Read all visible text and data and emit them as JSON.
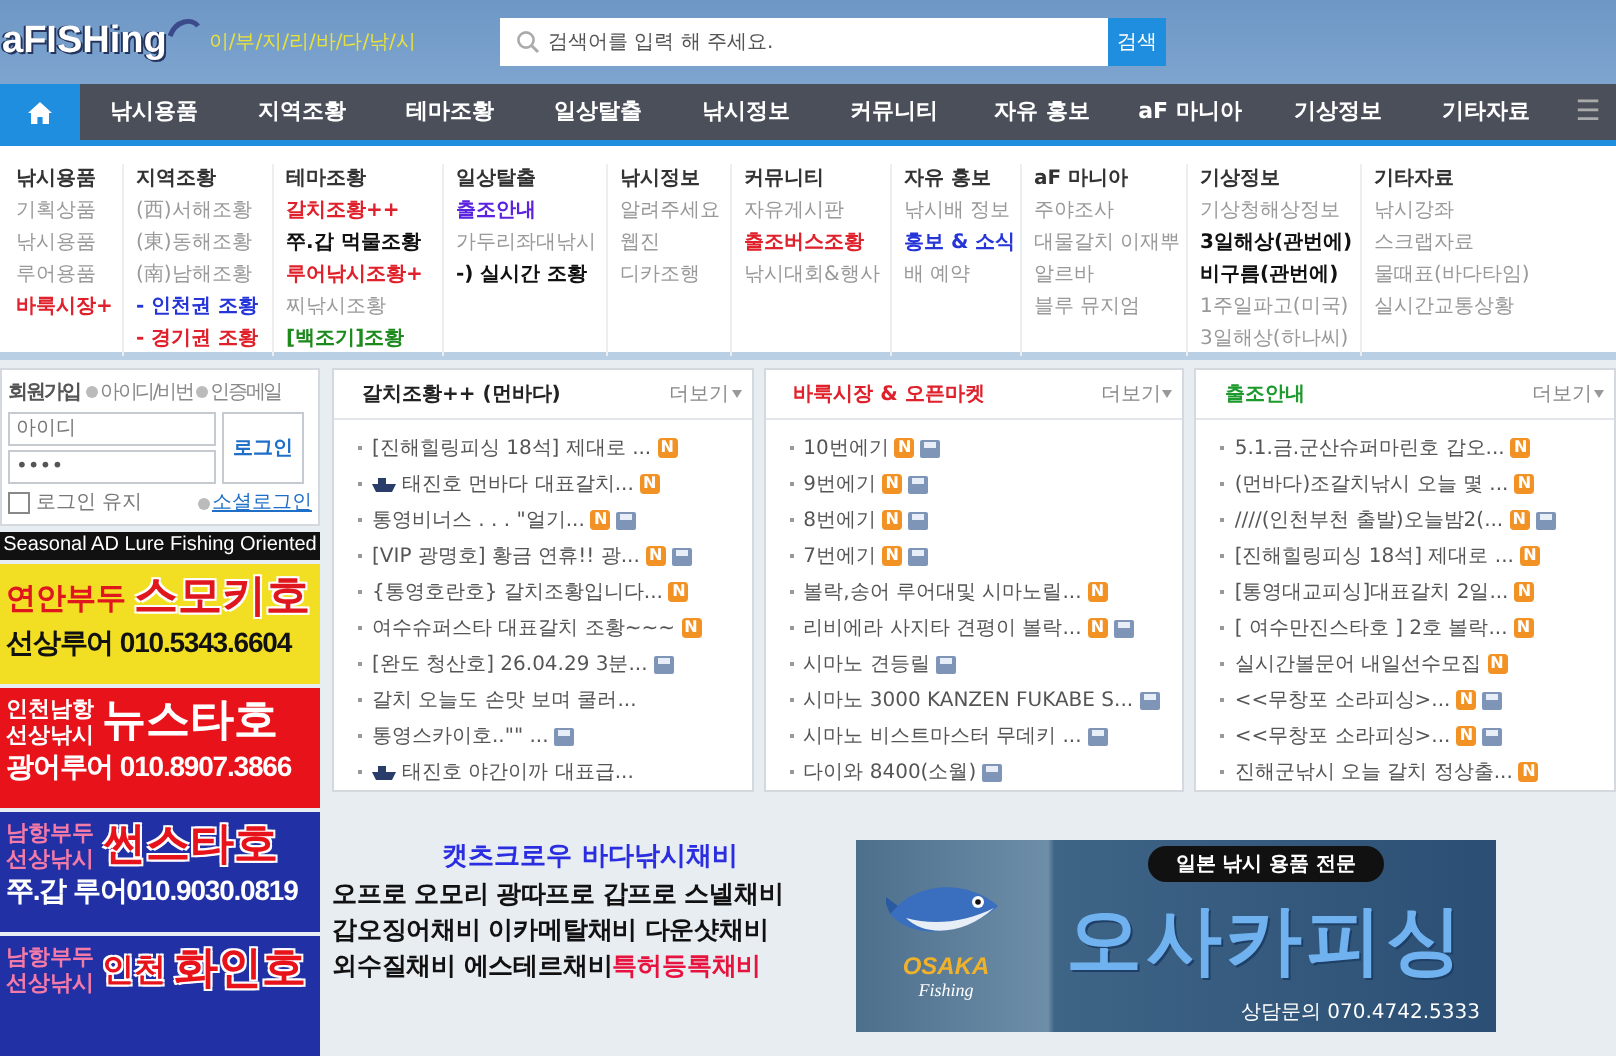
{
  "header": {
    "logo": "aFISHing",
    "slogan": "이/부/지/리/바/다/낚/시",
    "search": {
      "placeholder": "검색어를 입력 해 주세요.",
      "button": "검색"
    }
  },
  "nav": {
    "items": [
      {
        "label": "낚시용품",
        "selected": false
      },
      {
        "label": "지역조황",
        "selected": false
      },
      {
        "label": "테마조황",
        "selected": false
      },
      {
        "label": "일상탈출",
        "selected": false
      },
      {
        "label": "낚시정보",
        "selected": false
      },
      {
        "label": "커뮤니티",
        "selected": false
      },
      {
        "label": "자유 홍보",
        "selected": false
      },
      {
        "label": "aF 마니아",
        "selected": false
      },
      {
        "label": "기상정보",
        "selected": false
      },
      {
        "label": "기타자료",
        "selected": false
      }
    ],
    "home_selected": true,
    "menu_glyph": "☰"
  },
  "mega_menu": [
    {
      "heading": "낚시용품",
      "items": [
        {
          "label": "기획상품",
          "kind": "plain"
        },
        {
          "label": "낚시용품",
          "kind": "plain"
        },
        {
          "label": "루어용품",
          "kind": "plain"
        },
        {
          "label": "바룩시장+",
          "kind": "red"
        }
      ]
    },
    {
      "heading": "지역조황",
      "items": [
        {
          "label": "(西)서해조황",
          "kind": "plain"
        },
        {
          "label": "(東)동해조황",
          "kind": "plain"
        },
        {
          "label": "(南)남해조황",
          "kind": "plain"
        },
        {
          "label": "- 인천권 조황",
          "kind": "blue"
        },
        {
          "label": "- 경기권 조황",
          "kind": "red"
        }
      ]
    },
    {
      "heading": "테마조황",
      "items": [
        {
          "label": "갈치조황++",
          "kind": "red"
        },
        {
          "label": "쭈.갑 먹물조황",
          "kind": "black"
        },
        {
          "label": "루어낚시조황+",
          "kind": "red"
        },
        {
          "label": "찌낚시조황",
          "kind": "plain"
        },
        {
          "label": "[백조기]조황",
          "kind": "green"
        }
      ]
    },
    {
      "heading": "일상탈출",
      "items": [
        {
          "label": "출조안내",
          "kind": "purple"
        },
        {
          "label": "가두리좌대낚시",
          "kind": "plain"
        },
        {
          "label": "-) 실시간 조황",
          "kind": "black"
        }
      ]
    },
    {
      "heading": "낚시정보",
      "items": [
        {
          "label": "알려주세요",
          "kind": "plain"
        },
        {
          "label": "웹진",
          "kind": "plain"
        },
        {
          "label": "디카조행",
          "kind": "plain"
        }
      ]
    },
    {
      "heading": "커뮤니티",
      "items": [
        {
          "label": "자유게시판",
          "kind": "plain"
        },
        {
          "label": "출조버스조황",
          "kind": "red"
        },
        {
          "label": "낚시대회&행사",
          "kind": "plain"
        }
      ]
    },
    {
      "heading": "자유 홍보",
      "items": [
        {
          "label": "낚시배 정보",
          "kind": "plain"
        },
        {
          "label": "홍보 & 소식",
          "kind": "blue"
        },
        {
          "label": "배 예약",
          "kind": "plain"
        }
      ]
    },
    {
      "heading": "aF 마니아",
      "items": [
        {
          "label": "주야조사",
          "kind": "plain"
        },
        {
          "label": "대물갈치 이재뿌",
          "kind": "plain"
        },
        {
          "label": "알르바",
          "kind": "plain"
        },
        {
          "label": "블루 뮤지엄",
          "kind": "plain"
        }
      ]
    },
    {
      "heading": "기상정보",
      "items": [
        {
          "label": "기상청해상정보",
          "kind": "plain"
        },
        {
          "label": "3일해상(관번에)",
          "kind": "black"
        },
        {
          "label": "비구름(관번에)",
          "kind": "black"
        },
        {
          "label": "1주일파고(미국)",
          "kind": "plain"
        },
        {
          "label": "3일해상(하나씨)",
          "kind": "plain"
        }
      ]
    },
    {
      "heading": "기타자료",
      "items": [
        {
          "label": "낚시강좌",
          "kind": "plain"
        },
        {
          "label": "스크랩자료",
          "kind": "plain"
        },
        {
          "label": "물때표(바다타임)",
          "kind": "plain"
        },
        {
          "label": "실시간교통상황",
          "kind": "plain"
        }
      ]
    }
  ],
  "login": {
    "join": "회원가입",
    "find_id": "아이디/비번",
    "verify_mail": "인증메일",
    "id_placeholder": "아이디",
    "password": "••••",
    "button": "로그인",
    "keep_login": {
      "label": "로그인 유지",
      "checked": false
    },
    "social": "소셜로그인"
  },
  "ad_strip": "Seasonal AD Lure Fishing Oriented",
  "ads": [
    {
      "kind": "yellow",
      "region": [
        "연안부두"
      ],
      "name": "스모키호",
      "phone": "선상루어 010.5343.6604"
    },
    {
      "kind": "red",
      "region": [
        "인천남항",
        "선상낚시"
      ],
      "name": "뉴스타호",
      "phone": "광어루어 010.8907.3866"
    },
    {
      "kind": "blue",
      "region": [
        "남항부두",
        "선상낚시"
      ],
      "name": "썬스타호",
      "phone": "쭈.갑 루어010.9030.0819"
    },
    {
      "kind": "blue",
      "region": [
        "남항부두",
        "선상낚시"
      ],
      "prefix": "인천",
      "name": "화인호"
    }
  ],
  "panels": [
    {
      "title": "갈치조황++ (먼바다)",
      "color": "#222222",
      "more": "더보기",
      "items": [
        {
          "text": "[진해힐링피싱 18석] 제대로 ...",
          "badge": "N",
          "file": false,
          "boat": false
        },
        {
          "text": "태진호 먼바다 대표갈치...",
          "badge": "N",
          "file": false,
          "boat": true
        },
        {
          "text": "통영비너스 . . . \"얼기...",
          "badge": "N",
          "file": true,
          "boat": false
        },
        {
          "text": "[VIP 광명호] 황금 연휴!! 광...",
          "badge": "N",
          "file": true,
          "boat": false
        },
        {
          "text": "{통영호란호} 갈치조황입니다...",
          "badge": "N",
          "file": false,
          "boat": false
        },
        {
          "text": "여수슈퍼스타 대표갈치 조황~~~",
          "badge": "N",
          "file": false,
          "boat": false
        },
        {
          "text": "[완도 청산호] 26.04.29 3분...",
          "file": true,
          "boat": false
        },
        {
          "text": "갈치 오늘도 손맛 보며 쿨러...",
          "file": false,
          "boat": false
        },
        {
          "text": "통영스카이호..\"\" ...",
          "file": true,
          "boat": false
        },
        {
          "text": "태진호 야간이까 대표급...",
          "file": false,
          "boat": true
        }
      ]
    },
    {
      "title": "바룩시장 & 오픈마켓",
      "color": "#e0202a",
      "more": "더보기",
      "items": [
        {
          "text": "10번에기",
          "badge": "N",
          "file": true,
          "boat": false
        },
        {
          "text": "9번에기",
          "badge": "N",
          "file": true,
          "boat": false
        },
        {
          "text": "8번에기",
          "badge": "N",
          "file": true,
          "boat": false
        },
        {
          "text": "7번에기",
          "badge": "N",
          "file": true,
          "boat": false
        },
        {
          "text": "볼락,송어 루어대및 시마노릴...",
          "badge": "N",
          "file": false,
          "boat": false
        },
        {
          "text": "리비에라 사지타 견평이 볼락...",
          "badge": "N",
          "file": true,
          "boat": false
        },
        {
          "text": "시마노 견등릴",
          "file": true,
          "boat": false
        },
        {
          "text": "시마노 3000 KANZEN FUKABE S...",
          "file": true,
          "boat": false
        },
        {
          "text": "시마노 비스트마스터 무데키 ...",
          "file": true,
          "boat": false
        },
        {
          "text": "다이와 8400(소월)",
          "file": true,
          "boat": false
        }
      ]
    },
    {
      "title": "출조안내",
      "color": "#1d9a2d",
      "more": "더보기",
      "items": [
        {
          "text": "5.1.금.군산슈퍼마린호 갑오...",
          "badge": "N",
          "file": false,
          "boat": false
        },
        {
          "text": "(먼바다)조갈치낚시 오늘 몇 ...",
          "badge": "N",
          "file": false,
          "boat": false
        },
        {
          "text": "////(인천부천 출발)오늘밤2(...",
          "badge": "N",
          "file": true,
          "boat": false
        },
        {
          "text": "[진해힐링피싱 18석] 제대로 ...",
          "badge": "N",
          "file": false,
          "boat": false
        },
        {
          "text": "[통영대교피싱]대표갈치 2일...",
          "badge": "N",
          "file": false,
          "boat": false
        },
        {
          "text": "[ 여수만진스타호 ] 2호 볼락...",
          "badge": "N",
          "file": false,
          "boat": false
        },
        {
          "text": "실시간볼문어 내일선수모집",
          "badge": "N",
          "file": false,
          "boat": false
        },
        {
          "text": "<<무창포 소라피싱>...",
          "badge": "N",
          "file": true,
          "boat": false
        },
        {
          "text": "<<무창포 소라피싱>...",
          "badge": "N",
          "file": true,
          "boat": false
        },
        {
          "text": "진해군낚시 오늘 갈치 정상출...",
          "badge": "N",
          "file": false,
          "boat": false
        }
      ]
    }
  ],
  "text_ad": {
    "title": "캣츠크로우 바다낚시채비",
    "lines": [
      "오프로 오모리 광따프로 갑프로 스넬채비",
      "갑오징어채비 이카메탈채비 다운샷채비",
      "외수질채비 에스테르채비"
    ],
    "highlight": "특허등록채비"
  },
  "banner": {
    "logo_top": "OSAKA",
    "logo_bottom": "Fishing",
    "tag": "일본 낚시 용품 전문",
    "name": "오사카피싱",
    "contact": "상담문의 070.4742.5333"
  }
}
